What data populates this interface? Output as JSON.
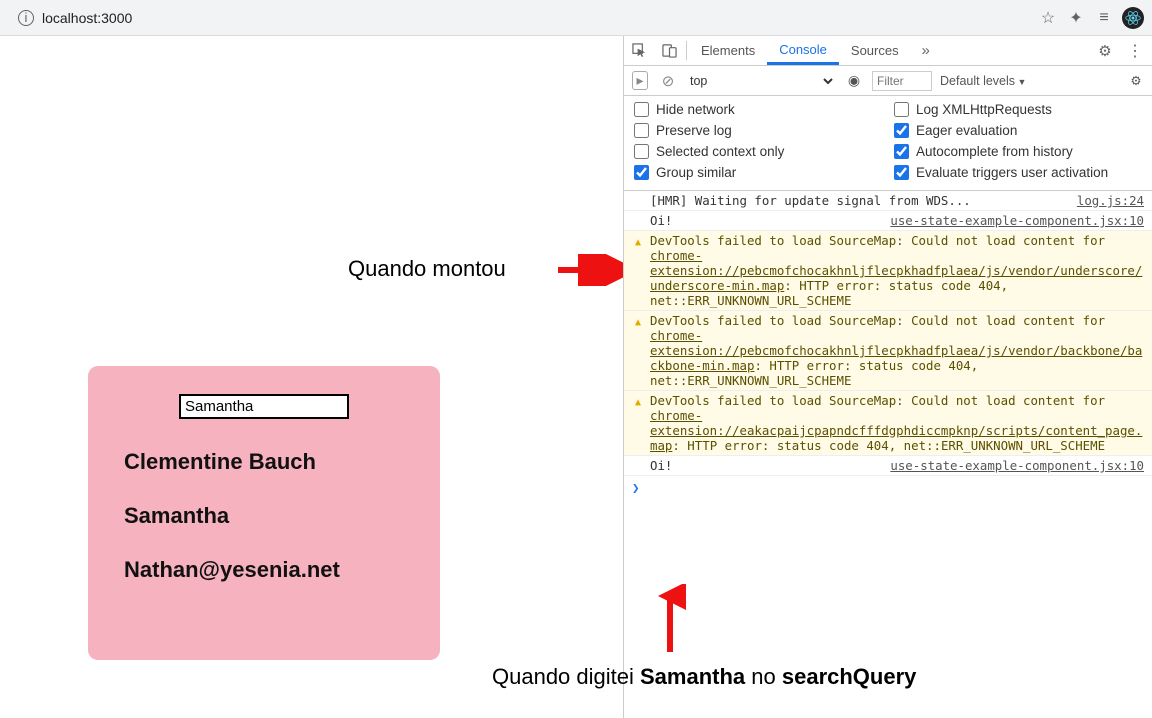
{
  "browser": {
    "url": "localhost:3000"
  },
  "card": {
    "search_value": "Samantha",
    "name": "Clementine Bauch",
    "username": "Samantha",
    "email": "Nathan@yesenia.net"
  },
  "annotations": {
    "mounted": "Quando montou",
    "typed_prefix": "Quando digitei ",
    "typed_query": "Samantha",
    "typed_mid": " no ",
    "typed_field": "searchQuery"
  },
  "devtools": {
    "tabs": {
      "elements": "Elements",
      "console": "Console",
      "sources": "Sources"
    },
    "context": "top",
    "filter_placeholder": "Filter",
    "levels": "Default levels",
    "settings": {
      "hide_network": "Hide network",
      "log_xhr": "Log XMLHttpRequests",
      "preserve_log": "Preserve log",
      "eager_eval": "Eager evaluation",
      "selected_ctx": "Selected context only",
      "autocomplete": "Autocomplete from history",
      "group_similar": "Group similar",
      "eval_triggers": "Evaluate triggers user activation"
    },
    "log": {
      "hmr": "[HMR] Waiting for update signal from WDS...",
      "hmr_src": "log.js:24",
      "oi": "Oi!",
      "oi_src": "use-state-example-component.jsx:10",
      "warn1_a": "DevTools failed to load SourceMap: Could not load content for ",
      "warn1_b": "chrome-extension://pebcmofchocakhnljflecpkhadfplaea/js/vendor/underscore/underscore-min.map",
      "warn1_c": ": HTTP error: status code 404, net::ERR_UNKNOWN_URL_SCHEME",
      "warn2_a": "DevTools failed to load SourceMap: Could not load content for ",
      "warn2_b": "chrome-extension://pebcmofchocakhnljflecpkhadfplaea/js/vendor/backbone/backbone-min.map",
      "warn2_c": ": HTTP error: status code 404, net::ERR_UNKNOWN_URL_SCHEME",
      "warn3_a": "DevTools failed to load SourceMap: Could not load content for ",
      "warn3_b": "chrome-extension://eakacpaijcpapndcfffdgphdiccmpknp/scripts/content_page.map",
      "warn3_c": ": HTTP error: status code 404, net::ERR_UNKNOWN_URL_SCHEME"
    }
  }
}
